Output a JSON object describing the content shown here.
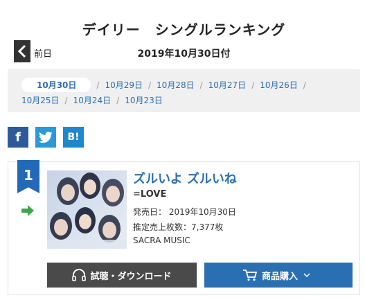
{
  "header": {
    "title": "デイリー　シングルランキング",
    "date": "2019年10月30日付",
    "prev_label": "前日"
  },
  "dates": {
    "row1": [
      "10月30日",
      "10月29日",
      "10月28日",
      "10月27日",
      "10月26日"
    ],
    "row2": [
      "10月25日",
      "10月24日",
      "10月23日"
    ],
    "separator": "/"
  },
  "social": {
    "facebook_label": "f",
    "hatena_label": "B!"
  },
  "entry": {
    "rank": "1",
    "title": "ズルいよ ズルいね",
    "artist": "=LOVE",
    "release_date": "発売日： 2019年10月30日",
    "sales": "推定売上枚数：7,377枚",
    "label": "SACRA MUSIC",
    "download_label": "試聴・ダウンロード",
    "buy_label": "商品購入"
  },
  "colors": {
    "accent": "#2a6fb2",
    "rank_flag": "#2468b8",
    "trend_up": "#3aa84a",
    "download_bg": "#4a4a4a",
    "facebook": "#2d5a9b",
    "twitter": "#2a9ad6",
    "hatena": "#1e88cf"
  }
}
